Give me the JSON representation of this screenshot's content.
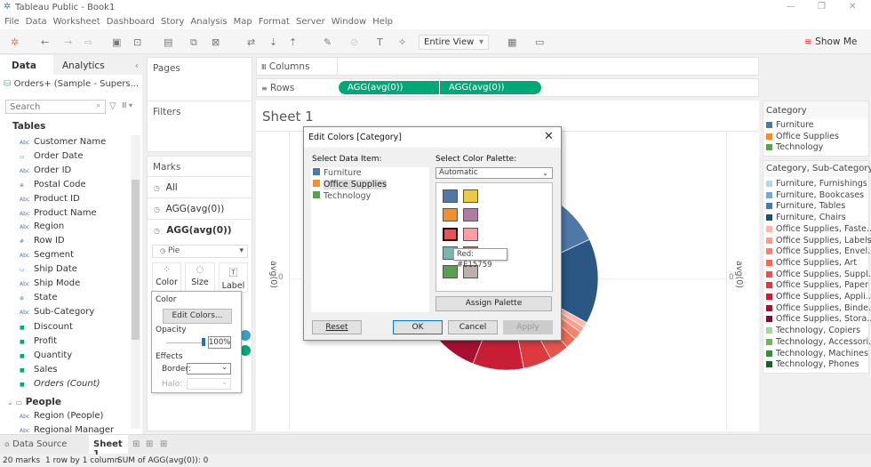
{
  "window": {
    "title": "Tableau Public - Book1",
    "minimize": "—",
    "restore": "❐",
    "close": "✕"
  },
  "menu": [
    "File",
    "Data",
    "Worksheet",
    "Dashboard",
    "Story",
    "Analysis",
    "Map",
    "Format",
    "Server",
    "Window",
    "Help"
  ],
  "toolbar": {
    "fit": "Entire View",
    "show_me": "Show Me"
  },
  "data_pane": {
    "tab_data": "Data",
    "tab_analytics": "Analytics",
    "datasource": "Orders+ (Sample - Supers...",
    "search_placeholder": "Search",
    "tables_label": "Tables",
    "dimensions": [
      {
        "t": "Abc",
        "n": "Customer Name"
      },
      {
        "t": "▭",
        "n": "Order Date"
      },
      {
        "t": "Abc",
        "n": "Order ID"
      },
      {
        "t": "⊕",
        "n": "Postal Code"
      },
      {
        "t": "Abc",
        "n": "Product ID"
      },
      {
        "t": "Abc",
        "n": "Product Name"
      },
      {
        "t": "Abc",
        "n": "Region"
      },
      {
        "t": "#",
        "n": "Row ID"
      },
      {
        "t": "Abc",
        "n": "Segment"
      },
      {
        "t": "▭",
        "n": "Ship Date"
      },
      {
        "t": "Abc",
        "n": "Ship Mode"
      },
      {
        "t": "⊕",
        "n": "State"
      },
      {
        "t": "Abc",
        "n": "Sub-Category"
      }
    ],
    "measures": [
      "Discount",
      "Profit",
      "Quantity",
      "Sales",
      "Orders (Count)"
    ],
    "people_label": "People",
    "people": [
      "Region (People)",
      "Regional Manager"
    ]
  },
  "shelves": {
    "pages": "Pages",
    "filters": "Filters",
    "columns": "Columns",
    "rows": "Rows",
    "row_pills": [
      "AGG(avg(0))",
      "AGG(avg(0))"
    ]
  },
  "marks": {
    "title": "Marks",
    "items": [
      "All",
      "AGG(avg(0))",
      "AGG(avg(0))"
    ],
    "type": "Pie",
    "color": "Color",
    "size": "Size",
    "label": "Label"
  },
  "color_popup": {
    "color": "Color",
    "edit_colors": "Edit Colors...",
    "opacity": "Opacity",
    "opacity_value": "100%",
    "opacity_pct": 100,
    "effects": "Effects",
    "border": "Border:",
    "halo": "Halo:"
  },
  "sheet": {
    "title": "Sheet 1",
    "axis_left": "avg(0)",
    "axis_right": "avg(0)",
    "tick_left": "0",
    "tick_right": "0"
  },
  "pie_slices": [
    {
      "c": "#4e79a7",
      "s": 0.1
    },
    {
      "c": "#2a5783",
      "s": 0.15
    },
    {
      "c": "#fdb8a8",
      "s": 0.01
    },
    {
      "c": "#f8a08d",
      "s": 0.01
    },
    {
      "c": "#f4846c",
      "s": 0.015
    },
    {
      "c": "#ee6b57",
      "s": 0.02
    },
    {
      "c": "#e8534b",
      "s": 0.035
    },
    {
      "c": "#dc3a3f",
      "s": 0.05
    },
    {
      "c": "#c71e36",
      "s": 0.09
    },
    {
      "c": "#a80f30",
      "s": 0.12
    },
    {
      "c": "#8a0b27",
      "s": 0.08
    },
    {
      "c": "#a9d59c",
      "s": 0.05
    },
    {
      "c": "#6cb65f",
      "s": 0.08
    },
    {
      "c": "#3a8a3b",
      "s": 0.08
    },
    {
      "c": "#1d5e26",
      "s": 0.12
    }
  ],
  "dialog": {
    "title": "Edit Colors [Category]",
    "select_item": "Select Data Item:",
    "items": [
      {
        "n": "Furniture",
        "c": "#4e79a7"
      },
      {
        "n": "Office Supplies",
        "c": "#f28e2b"
      },
      {
        "n": "Technology",
        "c": "#59a14f"
      }
    ],
    "selected_item": "Office Supplies",
    "select_palette": "Select Color Palette:",
    "palette": "Automatic",
    "swatches": [
      "#4e79a7",
      "#edc948",
      "#f28e2b",
      "#b07aa1",
      "#e15759",
      "#ff9da7",
      "#76b7b2",
      "#9c755f",
      "#59a14f",
      "#bab0ac"
    ],
    "tooltip": "Red: #E15759",
    "assign": "Assign Palette",
    "reset": "Reset",
    "ok": "OK",
    "cancel": "Cancel",
    "apply": "Apply"
  },
  "legend_category": {
    "title": "Category",
    "items": [
      {
        "n": "Furniture",
        "c": "#4e79a7"
      },
      {
        "n": "Office Supplies",
        "c": "#f28e2b"
      },
      {
        "n": "Technology",
        "c": "#59a14f"
      }
    ]
  },
  "legend_sub": {
    "title": "Category, Sub-Category",
    "items": [
      {
        "n": "Furniture, Furnishings",
        "c": "#b5d6ef"
      },
      {
        "n": "Furniture, Bookcases",
        "c": "#7aa7d2"
      },
      {
        "n": "Furniture, Tables",
        "c": "#4e79a7"
      },
      {
        "n": "Furniture, Chairs",
        "c": "#1f4e79"
      },
      {
        "n": "Office Supplies, Faste..",
        "c": "#fdb8a8"
      },
      {
        "n": "Office Supplies, Labels",
        "c": "#f8a08d"
      },
      {
        "n": "Office Supplies, Envel..",
        "c": "#f4846c"
      },
      {
        "n": "Office Supplies, Art",
        "c": "#ee6b57"
      },
      {
        "n": "Office Supplies, Suppl..",
        "c": "#e8534b"
      },
      {
        "n": "Office Supplies, Paper",
        "c": "#dc3a3f"
      },
      {
        "n": "Office Supplies, Appli..",
        "c": "#c71e36"
      },
      {
        "n": "Office Supplies, Binde..",
        "c": "#a80f30"
      },
      {
        "n": "Office Supplies, Stora..",
        "c": "#8a0b27"
      },
      {
        "n": "Technology, Copiers",
        "c": "#a9d59c"
      },
      {
        "n": "Technology, Accessori..",
        "c": "#6cb65f"
      },
      {
        "n": "Technology, Machines",
        "c": "#3a8a3b"
      },
      {
        "n": "Technology, Phones",
        "c": "#1d5e26"
      }
    ]
  },
  "tabs": {
    "data_source": "Data Source",
    "sheet": "Sheet 1"
  },
  "status": {
    "marks": "20 marks",
    "rows": "1 row by 1 column",
    "sum": "SUM of AGG(avg(0)): 0"
  }
}
